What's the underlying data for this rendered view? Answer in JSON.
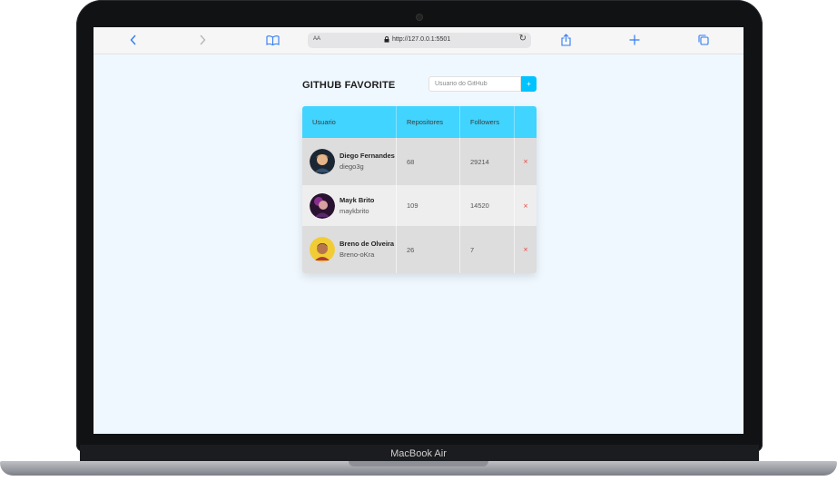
{
  "device": {
    "model_label": "MacBook Air"
  },
  "browser": {
    "text_size_label": "AA",
    "url": "http://127.0.0.1:5501",
    "icons": [
      "back-icon",
      "forward-icon",
      "book-icon",
      "lock-icon",
      "reload-icon",
      "share-icon",
      "plus-icon",
      "tabs-icon"
    ]
  },
  "app": {
    "title": "GITHUB FAVORITE",
    "search": {
      "placeholder": "Usuario do GitHub",
      "value": ""
    },
    "add_label": "+",
    "accent_color": "#40d4ff",
    "table": {
      "headers": [
        "Usuario",
        "Repositores",
        "Followers",
        ""
      ],
      "rows": [
        {
          "name": "Diego Fernandes",
          "login": "diego3g",
          "repos": "68",
          "followers": "29214",
          "remove": "×"
        },
        {
          "name": "Mayk Brito",
          "login": "maykbrito",
          "repos": "109",
          "followers": "14520",
          "remove": "×"
        },
        {
          "name": "Breno de Olveira",
          "login": "Breno-oKra",
          "repos": "26",
          "followers": "7",
          "remove": "×"
        }
      ]
    }
  }
}
